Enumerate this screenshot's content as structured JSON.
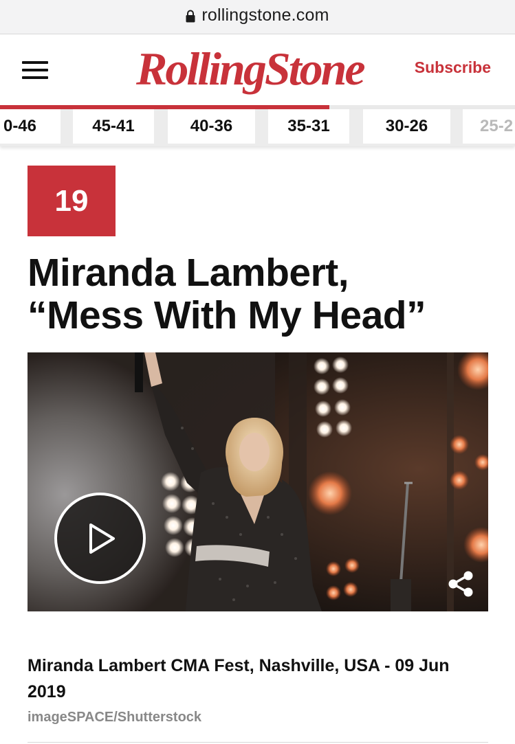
{
  "browser": {
    "url": "rollingstone.com",
    "lock_icon": "lock-icon"
  },
  "header": {
    "menu_icon": "hamburger-menu-icon",
    "logo_text": "RollingStone",
    "subscribe_label": "Subscribe",
    "brand_color": "#c8323a"
  },
  "range_nav": {
    "progress_fraction": 0.64,
    "tabs": [
      {
        "label": "0-46"
      },
      {
        "label": "45-41"
      },
      {
        "label": "40-36"
      },
      {
        "label": "35-31"
      },
      {
        "label": "30-26"
      },
      {
        "label": "25-2"
      }
    ]
  },
  "entry": {
    "rank": "19",
    "title_line1": "Miranda Lambert,",
    "title_line2": "“Mess With My Head”"
  },
  "media": {
    "play_icon": "play-icon",
    "share_icon": "share-icon"
  },
  "caption": {
    "text": "Miranda Lambert CMA Fest, Nashville, USA - 09 Jun 2019",
    "credit": "imageSPACE/Shutterstock"
  }
}
